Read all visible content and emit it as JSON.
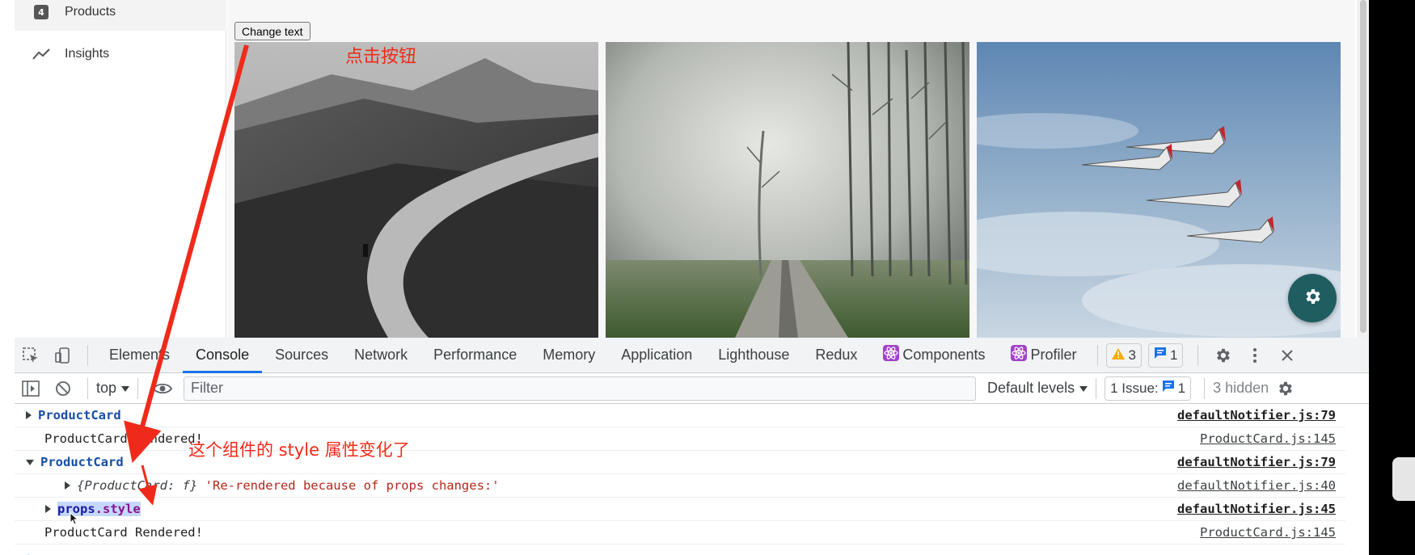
{
  "sidebar": {
    "items": [
      {
        "label": "Products",
        "icon": "products-icon"
      },
      {
        "label": "Insights",
        "icon": "trending-icon"
      }
    ]
  },
  "main": {
    "change_button_label": "Change text",
    "images": [
      {
        "description": "mountain-trail-photo"
      },
      {
        "description": "foggy-forest-road-photo"
      },
      {
        "description": "fighter-jets-formation-photo"
      }
    ],
    "fab_icon": "gear-icon"
  },
  "annotations": {
    "click_button": "点击按钮",
    "style_changed": "这个组件的 style 属性变化了"
  },
  "devtools": {
    "tabs": [
      "Elements",
      "Console",
      "Sources",
      "Network",
      "Performance",
      "Memory",
      "Application",
      "Lighthouse",
      "Redux",
      "Components",
      "Profiler"
    ],
    "active_tab": "Console",
    "warnings_count": "3",
    "messages_count": "1",
    "context": "top",
    "filter_placeholder": "Filter",
    "levels": "Default levels",
    "issues_label": "1 Issue:",
    "issues_count": "1",
    "hidden_label": "3 hidden",
    "accent": "#1a73e8",
    "console": [
      {
        "text": "ProductCard",
        "source": "defaultNotifier.js:79"
      },
      {
        "text": "ProductCard Rendered!",
        "source": "ProductCard.js:145"
      },
      {
        "text": "ProductCard",
        "source": "defaultNotifier.js:79"
      },
      {
        "obj": "{ProductCard: f}",
        "str": "'Re-rendered because of props changes:'",
        "source": "defaultNotifier.js:40"
      },
      {
        "prop_obj": "props",
        "prop_key": "style",
        "source": "defaultNotifier.js:45"
      },
      {
        "text": "ProductCard Rendered!",
        "source": "ProductCard.js:145"
      }
    ]
  }
}
